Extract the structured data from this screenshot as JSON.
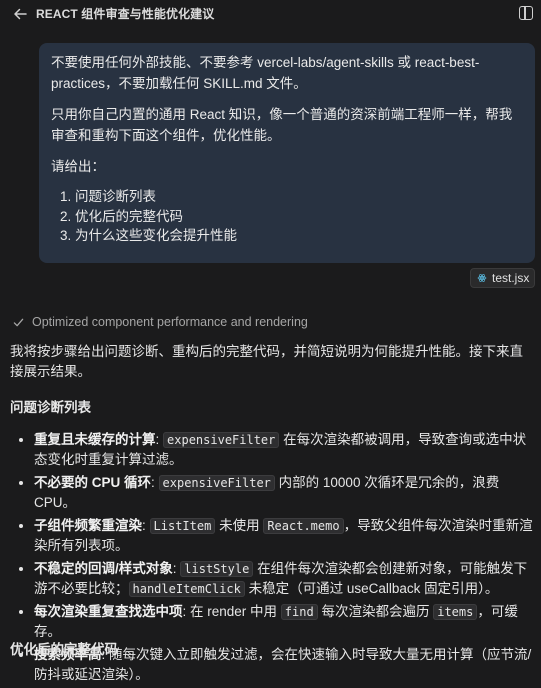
{
  "header": {
    "title": "REACT 组件审查与性能优化建议",
    "back_icon": "arrow-left-icon",
    "panel_icon": "sidebar-toggle-icon"
  },
  "user_message": {
    "p1": "不要使用任何外部技能、不要参考 vercel-labs/agent-skills 或 react-best-practices，不要加载任何 SKILL.md 文件。",
    "p2": "只用你自己内置的通用 React 知识，像一个普通的资深前端工程师一样，帮我审查和重构下面这个组件，优化性能。",
    "p3": "请给出：",
    "items": [
      "问题诊断列表",
      "优化后的完整代码",
      "为什么这些变化会提升性能"
    ]
  },
  "attachment": {
    "name": "test.jsx",
    "icon": "react-icon"
  },
  "status": {
    "text": "Optimized component performance and rendering",
    "icon": "check-icon"
  },
  "response": {
    "intro": "我将按步骤给出问题诊断、重构后的完整代码，并简短说明为何能提升性能。接下来直接展示结果。",
    "heading_diagnosis": "问题诊断列表",
    "issues": [
      {
        "title": "重复且未缓存的计算",
        "c1": "expensiveFilter",
        "t1": " 在每次渲染都被调用，导致查询或选中状态变化时重复计算过滤。"
      },
      {
        "title": "不必要的 CPU 循环",
        "c1": "expensiveFilter",
        "t1": " 内部的 10000 次循环是冗余的，浪费 CPU。"
      },
      {
        "title": "子组件频繁重渲染",
        "c1": "ListItem",
        "t1": " 未使用 ",
        "c2": "React.memo",
        "t2": "，导致父组件每次渲染时重新渲染所有列表项。"
      },
      {
        "title": "不稳定的回调/样式对象",
        "c1": "listStyle",
        "t1": " 在组件每次渲染都会创建新对象，可能触发下游不必要比较；",
        "c2": "handleItemClick",
        "t2": " 未稳定（可通过 useCallback 固定引用）。"
      },
      {
        "title": "每次渲染重复查找选中项",
        "t0": " 在 render 中用 ",
        "c1": "find",
        "t1": " 每次渲染都会遍历 ",
        "c2": "items",
        "t2": "，可缓存。"
      },
      {
        "title": "搜索频率高",
        "t0": " 随每次键入立即触发过滤，会在快速输入时导致大量无用计算（应节流/防抖或延迟渲染）。"
      }
    ],
    "heading_optimized": "优化后的完整代码"
  }
}
